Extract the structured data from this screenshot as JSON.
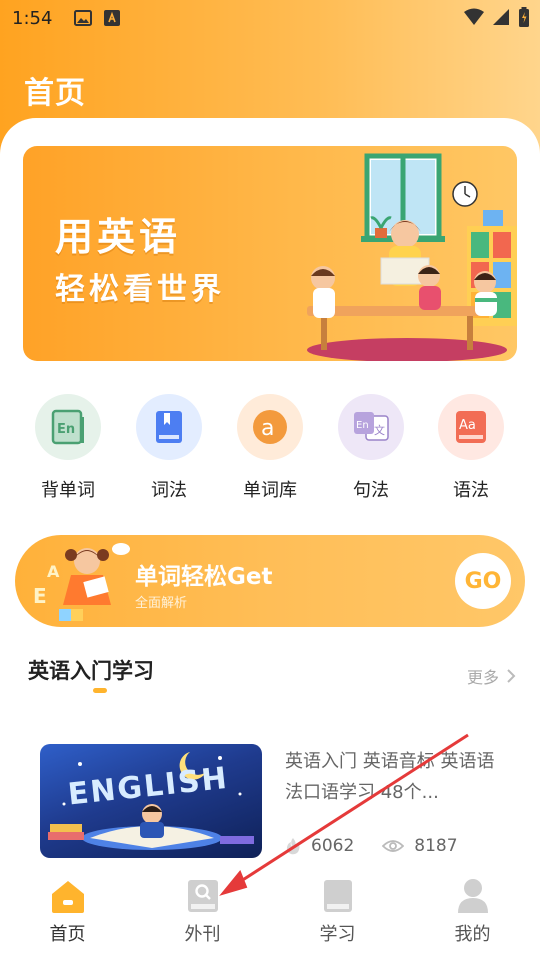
{
  "status_bar": {
    "time": "1:54"
  },
  "header": {
    "title": "首页"
  },
  "banner": {
    "line1": "用英语",
    "line2": "轻松看世界"
  },
  "quick_actions": [
    {
      "label": "背单词",
      "icon": "en-book-icon",
      "color": "#e8f3ec"
    },
    {
      "label": "词法",
      "icon": "bookmark-book-icon",
      "color": "#e6efff"
    },
    {
      "label": "单词库",
      "icon": "letter-a-icon",
      "color": "#ffeede"
    },
    {
      "label": "句法",
      "icon": "translate-icon",
      "color": "#efe9f8"
    },
    {
      "label": "语法",
      "icon": "aa-book-icon",
      "color": "#ffe9e4"
    }
  ],
  "promo": {
    "title": "单词轻松Get",
    "subtitle": "全面解析",
    "button": "GO"
  },
  "section": {
    "title": "英语入门学习",
    "more": "更多"
  },
  "course": {
    "description": "英语入门 英语音标 英语语法口语学习 48个...",
    "thumb_text": "ENGLISH",
    "likes": "6062",
    "views": "8187"
  },
  "tabs": [
    {
      "label": "首页",
      "icon": "home-icon",
      "active": true
    },
    {
      "label": "外刊",
      "icon": "magazine-icon",
      "active": false
    },
    {
      "label": "学习",
      "icon": "study-book-icon",
      "active": false
    },
    {
      "label": "我的",
      "icon": "profile-icon",
      "active": false
    }
  ],
  "colors": {
    "accent": "#ffb42d",
    "inactive_icon": "#cfcfcf"
  }
}
